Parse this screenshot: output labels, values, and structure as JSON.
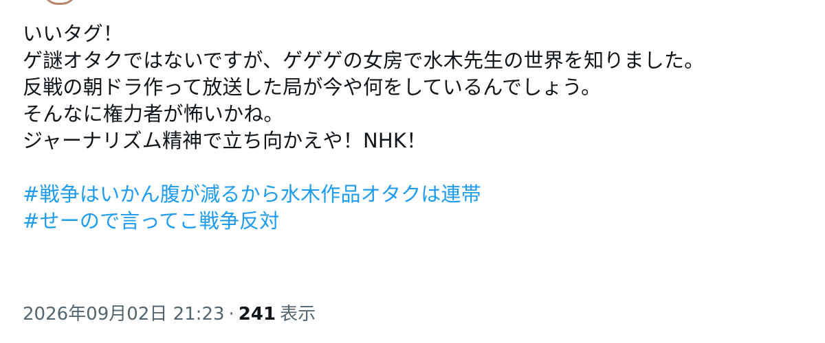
{
  "tweet": {
    "lines": [
      "いいタグ！",
      "ゲ謎オタクではないですが、ゲゲゲの女房で水木先生の世界を知りました。",
      "反戦の朝ドラ作って放送した局が今や何をしているんでしょう。",
      "そんなに権力者が怖いかね。",
      "ジャーナリズム精神で立ち向かえや！NHK！"
    ],
    "hashtags": [
      "#戦争はいかん腹が減るから水木作品オタクは連帯",
      "#せーので言ってこ戦争反対"
    ]
  },
  "meta": {
    "timestamp": "2026年09月02日 21:23",
    "separator": "·",
    "views_count": "241",
    "views_label": "表示"
  },
  "colors": {
    "text": "#0f1419",
    "link": "#1d9bf0",
    "secondary": "#536471"
  },
  "icons": {
    "avatar": "avatar-fragment"
  }
}
